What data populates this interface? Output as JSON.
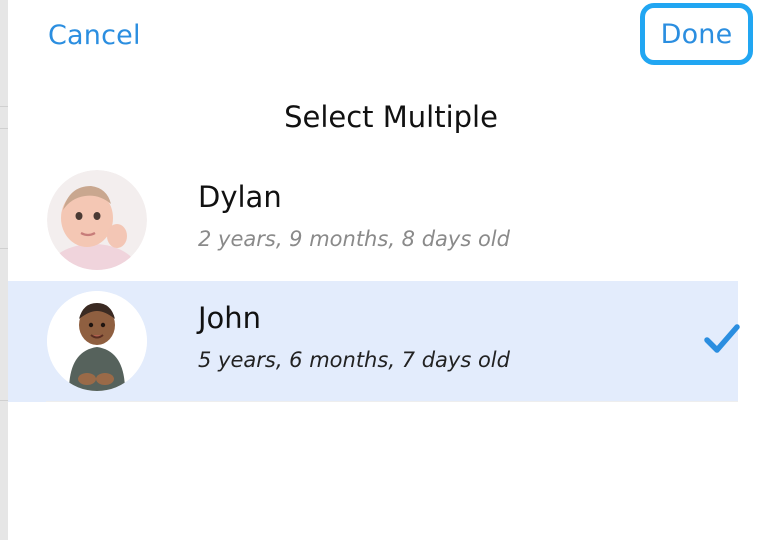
{
  "header": {
    "cancel_label": "Cancel",
    "done_label": "Done",
    "title": "Select Multiple"
  },
  "children": [
    {
      "name": "Dylan",
      "age": "2 years, 9 months, 8 days old",
      "selected": false
    },
    {
      "name": "John",
      "age": "5 years, 6 months, 7 days old",
      "selected": true
    }
  ],
  "icons": {
    "check": "checkmark-icon"
  },
  "colors": {
    "accent": "#2b8ee0",
    "focus_ring": "#21a6f2",
    "selected_row": "#e3ecfc"
  }
}
